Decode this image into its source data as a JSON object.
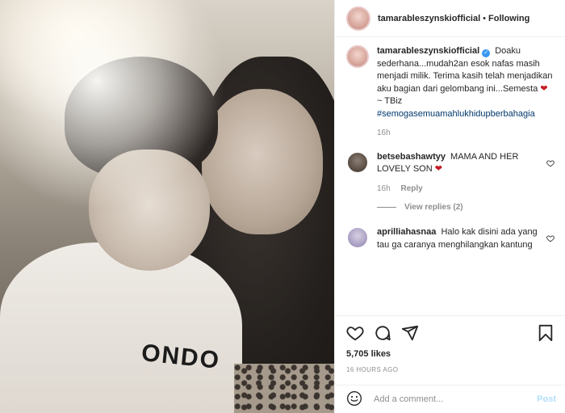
{
  "post": {
    "photo_print": "ONDO"
  },
  "header": {
    "username": "tamarableszynskiofficial",
    "dot": "•",
    "follow_status": "Following"
  },
  "caption": {
    "username": "tamarableszynskiofficial",
    "text": "Doaku sederhana...mudah2an esok nafas masih menjadi milik. Terima kasih telah menjadikan aku bagian dari gelombang ini...Semesta",
    "emoji": "❤",
    "sign": " ~ TBiz",
    "hashtag": "#semogasemuamahlukhidupberbahagia",
    "time": "16h"
  },
  "comments": [
    {
      "username": "betsebashawtyy",
      "text": "MAMA AND HER LOVELY SON",
      "emoji": "❤",
      "time": "16h",
      "reply_label": "Reply",
      "view_replies": "View replies (2)"
    },
    {
      "username": "aprilliahasnaa",
      "text": "Halo kak disini ada yang tau ga caranya menghilangkan kantung"
    }
  ],
  "actions": {
    "likes": "5,705 likes",
    "time_ago": "16 HOURS AGO"
  },
  "composer": {
    "placeholder": "Add a comment...",
    "post_label": "Post"
  },
  "icons": [
    "emoji-icon",
    "heart-icon",
    "comment-icon",
    "share-icon",
    "bookmark-icon",
    "verified-icon"
  ]
}
